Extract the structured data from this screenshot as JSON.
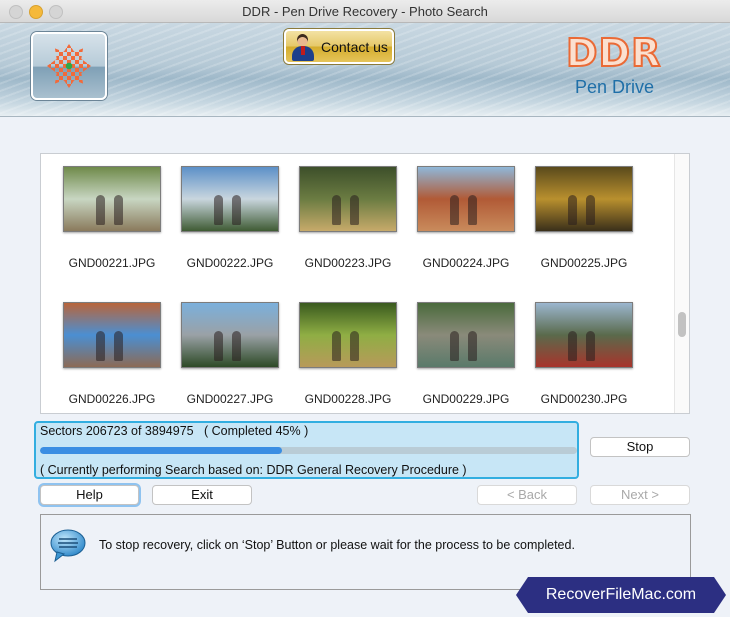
{
  "window": {
    "title": "DDR - Pen Drive Recovery - Photo Search"
  },
  "header": {
    "contact_label": "Contact us",
    "brand_main": "DDR",
    "brand_sub": "Pen Drive"
  },
  "gallery": {
    "items": [
      {
        "filename": "GND00221.JPG",
        "palette": [
          "#6f8a4a",
          "#c8d6c2",
          "#8a7a5c"
        ]
      },
      {
        "filename": "GND00222.JPG",
        "palette": [
          "#5c90c8",
          "#c9d6de",
          "#3f5b34"
        ]
      },
      {
        "filename": "GND00223.JPG",
        "palette": [
          "#3d4f2a",
          "#6b7c42",
          "#c7aa6a"
        ]
      },
      {
        "filename": "GND00224.JPG",
        "palette": [
          "#8fb7d9",
          "#b15a36",
          "#c98b5c"
        ]
      },
      {
        "filename": "GND00225.JPG",
        "palette": [
          "#5a4a1c",
          "#b9902e",
          "#3a2f1a"
        ]
      },
      {
        "filename": "GND00226.JPG",
        "palette": [
          "#b8643a",
          "#4b8fd2",
          "#8c6a55"
        ]
      },
      {
        "filename": "GND00227.JPG",
        "palette": [
          "#7bb0dc",
          "#9aa1a6",
          "#2d4a26"
        ]
      },
      {
        "filename": "GND00228.JPG",
        "palette": [
          "#3a5a1e",
          "#8fae44",
          "#b89a5a"
        ]
      },
      {
        "filename": "GND00229.JPG",
        "palette": [
          "#4a6a3c",
          "#8a8a7a",
          "#5a7a6a"
        ]
      },
      {
        "filename": "GND00230.JPG",
        "palette": [
          "#9bb6cf",
          "#5a6a4c",
          "#a8342c"
        ]
      }
    ]
  },
  "progress": {
    "sectors_text": "Sectors 206723 of 3894975   ( Completed 45% )",
    "percent": 45,
    "procedure_text": "( Currently performing Search based on: DDR General Recovery Procedure )"
  },
  "buttons": {
    "stop": "Stop",
    "help": "Help",
    "exit": "Exit",
    "back": "< Back",
    "next": "Next >"
  },
  "info": {
    "message": "To stop recovery, click on ‘Stop’ Button or please wait for the process to be completed."
  },
  "watermark": {
    "text": "RecoverFileMac.com"
  },
  "colors": {
    "accent_blue": "#32aee0",
    "progress_fill": "#3a8ee3",
    "brand_orange": "#ea6a36",
    "brand_blue": "#1f6fa8",
    "watermark_bg": "#2c2f82"
  }
}
